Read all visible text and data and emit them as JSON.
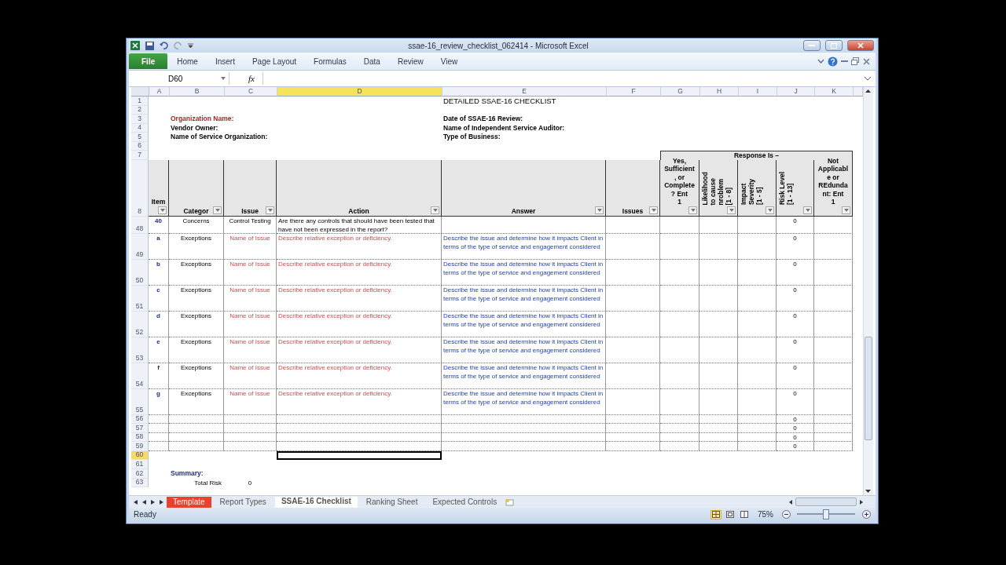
{
  "window": {
    "title": "ssae-16_review_checklist_062414  -  Microsoft Excel"
  },
  "ribbon": {
    "file_button": "File",
    "tabs": [
      "Home",
      "Insert",
      "Page Layout",
      "Formulas",
      "Data",
      "Review",
      "View"
    ]
  },
  "formula_bar": {
    "name_box": "D60",
    "function_label": "fx"
  },
  "column_headers": [
    {
      "label": "A",
      "selected": false
    },
    {
      "label": "B",
      "selected": false
    },
    {
      "label": "C",
      "selected": false
    },
    {
      "label": "D",
      "selected": true
    },
    {
      "label": "E",
      "selected": false
    },
    {
      "label": "F",
      "selected": false
    },
    {
      "label": "G",
      "selected": false
    },
    {
      "label": "H",
      "selected": false
    },
    {
      "label": "I",
      "selected": false
    },
    {
      "label": "J",
      "selected": false
    },
    {
      "label": "K",
      "selected": false
    }
  ],
  "rows": [
    {
      "num": "1",
      "kind": "title",
      "selected": false,
      "text": "DETAILED SSAE-16 CHECKLIST"
    },
    {
      "num": "2",
      "kind": "blank",
      "selected": false
    },
    {
      "num": "3",
      "kind": "info",
      "selected": false,
      "left": {
        "text": "Organization Name:",
        "color": "#a3262a"
      },
      "right": {
        "text": "Date of SSAE-16 Review:",
        "color": "#000000"
      }
    },
    {
      "num": "4",
      "kind": "info",
      "selected": false,
      "left": {
        "text": "Vendor Owner:",
        "color": "#000000"
      },
      "right": {
        "text": "Name of Independent Service Auditor:",
        "color": "#000000"
      }
    },
    {
      "num": "5",
      "kind": "info",
      "selected": false,
      "left": {
        "text": "Name of Service Organization:",
        "color": "#000000"
      },
      "right": {
        "text": "Type of Business:",
        "color": "#000000"
      }
    },
    {
      "num": "6",
      "kind": "blank",
      "selected": false
    },
    {
      "num": "7",
      "kind": "group_header",
      "selected": false,
      "text": "Response Is –"
    },
    {
      "num": "8",
      "kind": "column_header",
      "selected": false,
      "headers": [
        {
          "text": "Item",
          "kind": "plain"
        },
        {
          "text": "Categor",
          "kind": "plain"
        },
        {
          "text": "Issue",
          "kind": "plain"
        },
        {
          "text": "Action",
          "kind": "plain"
        },
        {
          "text": "Answer",
          "kind": "plain"
        },
        {
          "text": "Issues",
          "kind": "plain"
        },
        {
          "text": "Yes,\nSufficient\n, or\nComplete\n? Ent\n1",
          "kind": "plain"
        },
        {
          "text": "Likelihood\nto cause\nnroblem\n[1 - 8]",
          "kind": "rotated"
        },
        {
          "text": "Impact\nSeverity\n[1 - 5]",
          "kind": "rotated"
        },
        {
          "text": "Risk Level\n[1 - 13]",
          "kind": "rotated"
        },
        {
          "text": "Not\nApplicabl\ne or\nREdunda\nnt: Ent\n1",
          "kind": "plain"
        }
      ]
    },
    {
      "num": "48",
      "kind": "concern_item",
      "selected": false,
      "item": "40",
      "category": "Concerns",
      "issue": "Control Testing",
      "action": "Are there any controls that should have been tested that have not been expressed in the report?",
      "risk": "0"
    },
    {
      "num": "49",
      "kind": "exception_item",
      "selected": false,
      "item": "a",
      "category": "Exceptions",
      "issue": "Name of Issue",
      "action": "Describe relative exception or deficiency.",
      "answer": "Describe the issue and determine how it impacts Client in terms of the type of service and engagement considered",
      "risk": "0"
    },
    {
      "num": "50",
      "kind": "exception_item",
      "selected": false,
      "item": "b",
      "category": "Exceptions",
      "issue": "Name of Issue",
      "action": "Describe relative exception or deficiency.",
      "answer": "Describe the issue and determine how it impacts Client in terms of the type of service and engagement considered",
      "risk": "0"
    },
    {
      "num": "51",
      "kind": "exception_item",
      "selected": false,
      "item": "c",
      "category": "Exceptions",
      "issue": "Name of Issue",
      "action": "Describe relative exception or deficiency.",
      "answer": "Describe the issue and determine how it impacts Client in terms of the type of service and engagement considered",
      "risk": "0"
    },
    {
      "num": "52",
      "kind": "exception_item",
      "selected": false,
      "item": "d",
      "category": "Exceptions",
      "issue": "Name of Issue",
      "action": "Describe relative exception or deficiency.",
      "answer": "Describe the issue and determine how it impacts Client in terms of the type of service and engagement considered",
      "risk": "0"
    },
    {
      "num": "53",
      "kind": "exception_item",
      "selected": false,
      "item": "e",
      "category": "Exceptions",
      "issue": "Name of Issue",
      "action": "Describe relative exception or deficiency.",
      "answer": "Describe the issue and determine how it impacts Client in terms of the type of service and engagement considered",
      "risk": "0"
    },
    {
      "num": "54",
      "kind": "exception_item",
      "selected": false,
      "item": "f",
      "category": "Exceptions",
      "issue": "Name of Issue",
      "action": "Describe relative exception or deficiency.",
      "answer": "Describe the issue and determine how it impacts Client in terms of the type of service and engagement considered",
      "risk": "0"
    },
    {
      "num": "55",
      "kind": "exception_item",
      "selected": false,
      "item": "g",
      "category": "Exceptions",
      "issue": "Name of Issue",
      "action": "Describe relative exception or deficiency.",
      "answer": "Describe the issue and determine how it impacts Client in terms of the type of service and engagement considered",
      "risk": "0"
    },
    {
      "num": "56",
      "kind": "empty_item",
      "selected": false,
      "risk": "0"
    },
    {
      "num": "57",
      "kind": "empty_item",
      "selected": false,
      "risk": "0"
    },
    {
      "num": "58",
      "kind": "empty_item",
      "selected": false,
      "risk": "0"
    },
    {
      "num": "59",
      "kind": "empty_item",
      "selected": false,
      "risk": "0"
    },
    {
      "num": "60",
      "kind": "blank",
      "selected": true
    },
    {
      "num": "61",
      "kind": "blank",
      "selected": false
    },
    {
      "num": "62",
      "kind": "summary_heading",
      "selected": false,
      "text": "Summary:"
    },
    {
      "num": "63",
      "kind": "summary_value",
      "selected": false,
      "label": "Total Risk",
      "value": "0"
    }
  ],
  "sheet_tabs": [
    {
      "label": "Template",
      "selected": false,
      "color": "#e8412c"
    },
    {
      "label": "Report Types",
      "selected": false
    },
    {
      "label": "SSAE-16 Checklist",
      "selected": true
    },
    {
      "label": "Ranking Sheet",
      "selected": false
    },
    {
      "label": "Expected Controls",
      "selected": false
    }
  ],
  "status_bar": {
    "status": "Ready",
    "zoom": "75%",
    "zoom_slider": {
      "level": 0.5
    }
  }
}
